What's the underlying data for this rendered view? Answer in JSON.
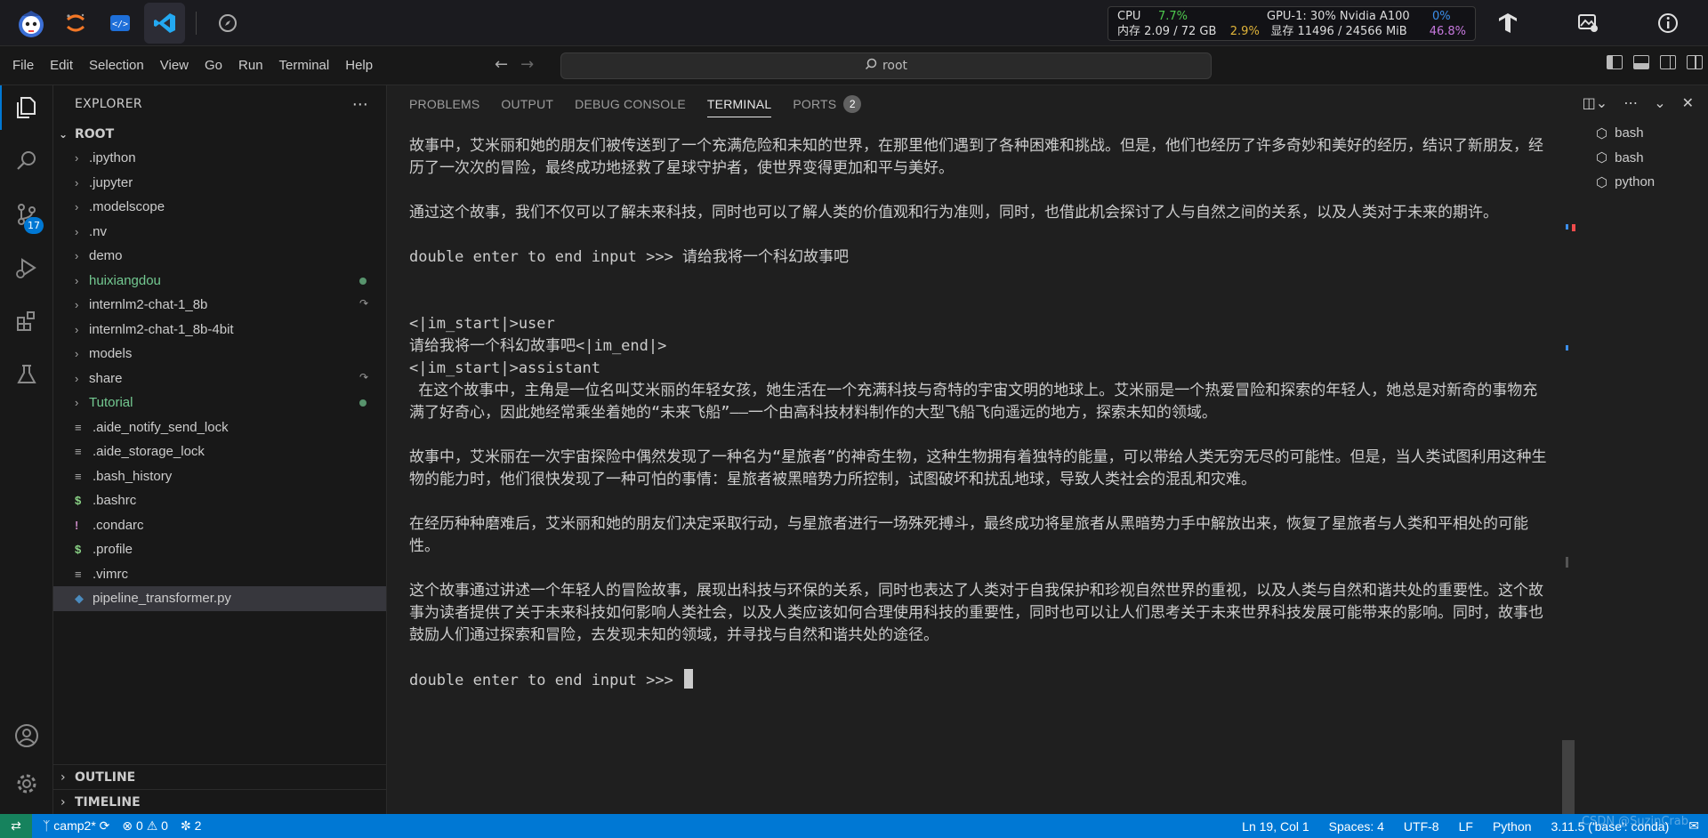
{
  "topbar": {
    "apps": [
      "mascot-logo",
      "jupyter-icon",
      "code-editor-icon",
      "vscode-icon",
      "compass-icon"
    ],
    "stats": {
      "cpu_label": "CPU",
      "cpu_value": "7.7%",
      "mem_label": "内存 2.09 / 72 GB",
      "mem_value": "2.9%",
      "gpu_label": "GPU-1: 30% Nvidia A100",
      "gpu_value": "0%",
      "vram_label": "显存 11496 / 24566 MiB",
      "vram_value": "46.8%"
    }
  },
  "menubar": {
    "items": [
      "File",
      "Edit",
      "Selection",
      "View",
      "Go",
      "Run",
      "Terminal",
      "Help"
    ],
    "search_text": "root"
  },
  "activity": {
    "scm_badge": "17"
  },
  "explorer": {
    "title": "EXPLORER",
    "root": "ROOT",
    "items": [
      {
        "label": ".ipython",
        "type": "folder"
      },
      {
        "label": ".jupyter",
        "type": "folder"
      },
      {
        "label": ".modelscope",
        "type": "folder"
      },
      {
        "label": ".nv",
        "type": "folder"
      },
      {
        "label": "demo",
        "type": "folder"
      },
      {
        "label": "huixiangdou",
        "type": "folder"
      },
      {
        "label": "internlm2-chat-1_8b",
        "type": "folder"
      },
      {
        "label": "internlm2-chat-1_8b-4bit",
        "type": "folder"
      },
      {
        "label": "models",
        "type": "folder"
      },
      {
        "label": "share",
        "type": "folder"
      },
      {
        "label": "Tutorial",
        "type": "folder"
      },
      {
        "label": ".aide_notify_send_lock",
        "type": "file"
      },
      {
        "label": ".aide_storage_lock",
        "type": "file"
      },
      {
        "label": ".bash_history",
        "type": "file"
      },
      {
        "label": ".bashrc",
        "type": "file"
      },
      {
        "label": ".condarc",
        "type": "file"
      },
      {
        "label": ".profile",
        "type": "file"
      },
      {
        "label": ".vimrc",
        "type": "file"
      },
      {
        "label": "pipeline_transformer.py",
        "type": "file"
      }
    ],
    "outline": "OUTLINE",
    "timeline": "TIMELINE"
  },
  "panel": {
    "tabs": [
      "PROBLEMS",
      "OUTPUT",
      "DEBUG CONSOLE",
      "TERMINAL",
      "PORTS"
    ],
    "ports_count": "2",
    "terminals": [
      "bash",
      "bash",
      "python"
    ]
  },
  "terminal": {
    "lines": [
      "故事中，艾米丽和她的朋友们被传送到了一个充满危险和未知的世界，在那里他们遇到了各种困难和挑战。但是，他们也经历了许多奇妙和美好的经历，结识了新朋友，经历了一次次的冒险，最终成功地拯救了星球守护者，使世界变得更加和平与美好。",
      "",
      "通过这个故事，我们不仅可以了解未来科技，同时也可以了解人类的价值观和行为准则，同时，也借此机会探讨了人与自然之间的关系，以及人类对于未来的期许。",
      "",
      "double enter to end input >>> 请给我将一个科幻故事吧",
      "",
      "",
      "<|im_start|>user",
      "请给我将一个科幻故事吧<|im_end|>",
      "<|im_start|>assistant",
      " 在这个故事中，主角是一位名叫艾米丽的年轻女孩，她生活在一个充满科技与奇特的宇宙文明的地球上。艾米丽是一个热爱冒险和探索的年轻人，她总是对新奇的事物充满了好奇心，因此她经常乘坐着她的“未来飞船”——一个由高科技材料制作的大型飞船飞向遥远的地方，探索未知的领域。",
      "",
      "故事中，艾米丽在一次宇宙探险中偶然发现了一种名为“星旅者”的神奇生物，这种生物拥有着独特的能量，可以带给人类无穷无尽的可能性。但是，当人类试图利用这种生物的能力时，他们很快发现了一种可怕的事情：星旅者被黑暗势力所控制，试图破坏和扰乱地球，导致人类社会的混乱和灾难。",
      "",
      "在经历种种磨难后，艾米丽和她的朋友们决定采取行动，与星旅者进行一场殊死搏斗，最终成功将星旅者从黑暗势力手中解放出来，恢复了星旅者与人类和平相处的可能性。",
      "",
      "这个故事通过讲述一个年轻人的冒险故事，展现出科技与环保的关系，同时也表达了人类对于自我保护和珍视自然世界的重视，以及人类与自然和谐共处的重要性。这个故事为读者提供了关于未来科技如何影响人类社会，以及人类应该如何合理使用科技的重要性，同时也可以让人们思考关于未来世界科技发展可能带来的影响。同时，故事也鼓励人们通过探索和冒险，去发现未知的领域，并寻找与自然和谐共处的途径。",
      "",
      "double enter to end input >>> "
    ]
  },
  "statusbar": {
    "branch": "camp2*",
    "errors": "0",
    "warnings": "0",
    "ports": "2",
    "position": "Ln 19, Col 1",
    "spaces": "Spaces: 4",
    "encoding": "UTF-8",
    "eol": "LF",
    "language": "Python",
    "interpreter": "3.11.5 ('base': conda)",
    "watermark": "CSDN @SuzinCrab"
  }
}
